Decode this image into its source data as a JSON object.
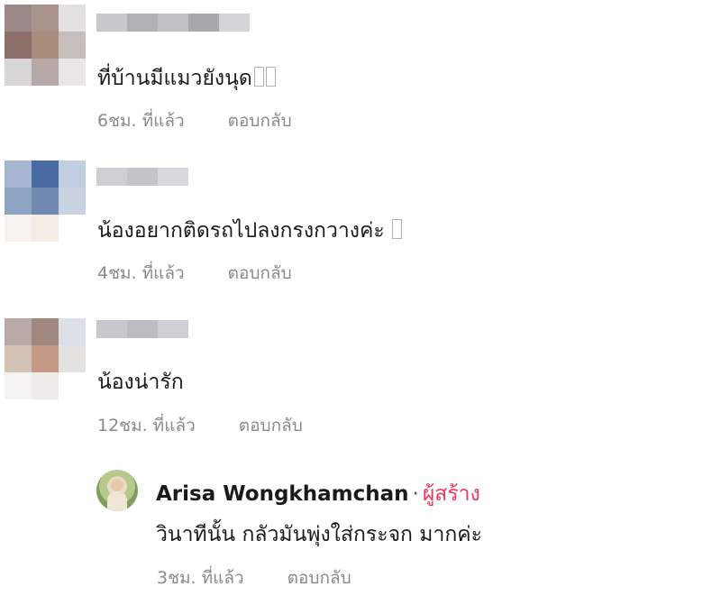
{
  "comments": [
    {
      "text": "ที่บ้านมีแมวยังนุด",
      "time": "6ชม. ที่แล้ว",
      "reply_label": "ตอบกลับ",
      "avatar_colors": [
        "#9b8a88",
        "#a8948a",
        "#e2e0e0",
        "#8c6f69",
        "#a98c7c",
        "#c7bdbd",
        "#d8d6d6",
        "#b7a9a8",
        "#e8e6e6"
      ],
      "name_colors": [
        "#c8c8cc",
        "#b0b0b6",
        "#c0c0c6",
        "#a8a8ae",
        "#d4d4d8"
      ]
    },
    {
      "text": "น้องอยากติดรถไปลงกรงกวางค่ะ",
      "time": "4ชม. ที่แล้ว",
      "reply_label": "ตอบกลับ",
      "avatar_colors": [
        "#a7b7d4",
        "#4a6aa3",
        "#c2cfe2",
        "#8fa3c2",
        "#7189b0",
        "#c9d2e0",
        "#f6f2f0",
        "#f3ebe4",
        "#ffffff"
      ],
      "name_colors": [
        "#cfcfd3",
        "#c4c4c9",
        "#d8d8dc"
      ]
    },
    {
      "text": "น้องน่ารัก",
      "time": "12ชม. ที่แล้ว",
      "reply_label": "ตอบกลับ",
      "avatar_colors": [
        "#b9aaa8",
        "#a08880",
        "#dde0e8",
        "#d3c2b6",
        "#c49a86",
        "#e4e1e1",
        "#f4f2f2",
        "#efebeb",
        "#ffffff"
      ],
      "name_colors": [
        "#c7c7cc",
        "#bcbcc1",
        "#cfcfd3"
      ]
    }
  ],
  "reply": {
    "author": "Arisa Wongkhamchan",
    "separator": "·",
    "badge": "ผู้สร้าง",
    "text": "วินาทีนั้น กลัวมันพุ่งใส่กระจก มากค่ะ",
    "time": "3ชม. ที่แล้ว",
    "reply_label": "ตอบกลับ",
    "colors": {
      "badge": "#f0355a",
      "meta": "#8a8a8a"
    }
  }
}
